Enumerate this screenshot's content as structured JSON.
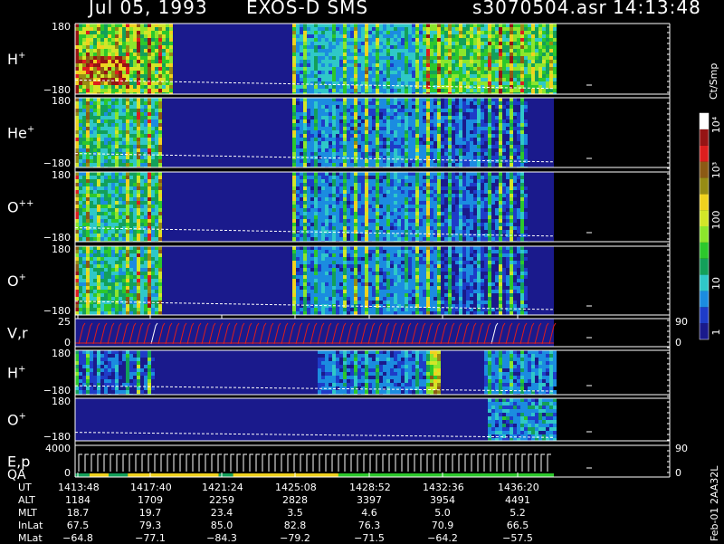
{
  "header": {
    "date": "Jul 05, 1993",
    "instrument": "EXOS-D SMS",
    "file": "s3070504.asr",
    "time": "14:13:48"
  },
  "colorbar": {
    "unit": "Ct/Smp",
    "tick_labels": [
      "1",
      "10",
      "100",
      "10³",
      "10⁴"
    ],
    "colors": [
      "#1a1a8c",
      "#1e3cc8",
      "#1b8ce0",
      "#2fc8c8",
      "#13a05a",
      "#2cc82c",
      "#8ce62c",
      "#d2e628",
      "#f0d21e",
      "#968c14",
      "#8c5a14",
      "#dc1e1e",
      "#961414",
      "#ffffff"
    ]
  },
  "footer": {
    "side_label": "Feb-01 2AA32L",
    "rows": [
      {
        "label": "UT",
        "values": [
          "1413:48",
          "1417:40",
          "1421:24",
          "1425:08",
          "1428:52",
          "1432:36",
          "1436:20"
        ]
      },
      {
        "label": "ALT",
        "values": [
          "1184",
          "1709",
          "2259",
          "2828",
          "3397",
          "3954",
          "4491"
        ]
      },
      {
        "label": "MLT",
        "values": [
          "18.7",
          "19.7",
          "23.4",
          "3.5",
          "4.6",
          "5.0",
          "5.2"
        ]
      },
      {
        "label": "InLat",
        "values": [
          "67.5",
          "79.3",
          "85.0",
          "82.8",
          "76.3",
          "70.9",
          "66.5"
        ]
      },
      {
        "label": "MLat",
        "values": [
          "−64.8",
          "−77.1",
          "−84.3",
          "−79.2",
          "−71.5",
          "−64.2",
          "−57.5"
        ]
      }
    ]
  },
  "chart_data": {
    "type": "heatmap",
    "x_axis": {
      "quantity": "UT",
      "ticks": [
        "1413:48",
        "1417:40",
        "1421:24",
        "1425:08",
        "1428:52",
        "1432:36",
        "1436:20"
      ]
    },
    "panels": [
      {
        "label": "H",
        "sup": "+",
        "y_ticks": [
          "180",
          "−180"
        ],
        "ylim": [
          -180,
          180
        ],
        "kind": "spectrogram",
        "intensity_profile": "H"
      },
      {
        "label": "He",
        "sup": "+",
        "y_ticks": [
          "180",
          "−180"
        ],
        "ylim": [
          -180,
          180
        ],
        "kind": "spectrogram",
        "intensity_profile": "He"
      },
      {
        "label": "O",
        "sup": "++",
        "y_ticks": [
          "180",
          "−180"
        ],
        "ylim": [
          -180,
          180
        ],
        "kind": "spectrogram",
        "intensity_profile": "Opp"
      },
      {
        "label": "O",
        "sup": "+",
        "y_ticks": [
          "180",
          "−180"
        ],
        "ylim": [
          -180,
          180
        ],
        "kind": "spectrogram",
        "intensity_profile": "Op"
      },
      {
        "label": "V,r",
        "sup": "",
        "y_ticks": [
          "25",
          "0"
        ],
        "right_ticks": [
          "90",
          "0"
        ],
        "kind": "sawtooth"
      },
      {
        "label": "H",
        "sup": "+",
        "y_ticks": [
          "180",
          "−180"
        ],
        "ylim": [
          -180,
          180
        ],
        "kind": "spectrogram",
        "intensity_profile": "H2"
      },
      {
        "label": "O",
        "sup": "+",
        "y_ticks": [
          "180",
          "−180"
        ],
        "ylim": [
          -180,
          180
        ],
        "kind": "spectrogram",
        "intensity_profile": "O2"
      },
      {
        "label": "E,p",
        "sub_label": "QA",
        "sup": "",
        "y_ticks": [
          "4000",
          "0"
        ],
        "right_ticks": [
          "90",
          "0"
        ],
        "kind": "energy"
      }
    ]
  }
}
